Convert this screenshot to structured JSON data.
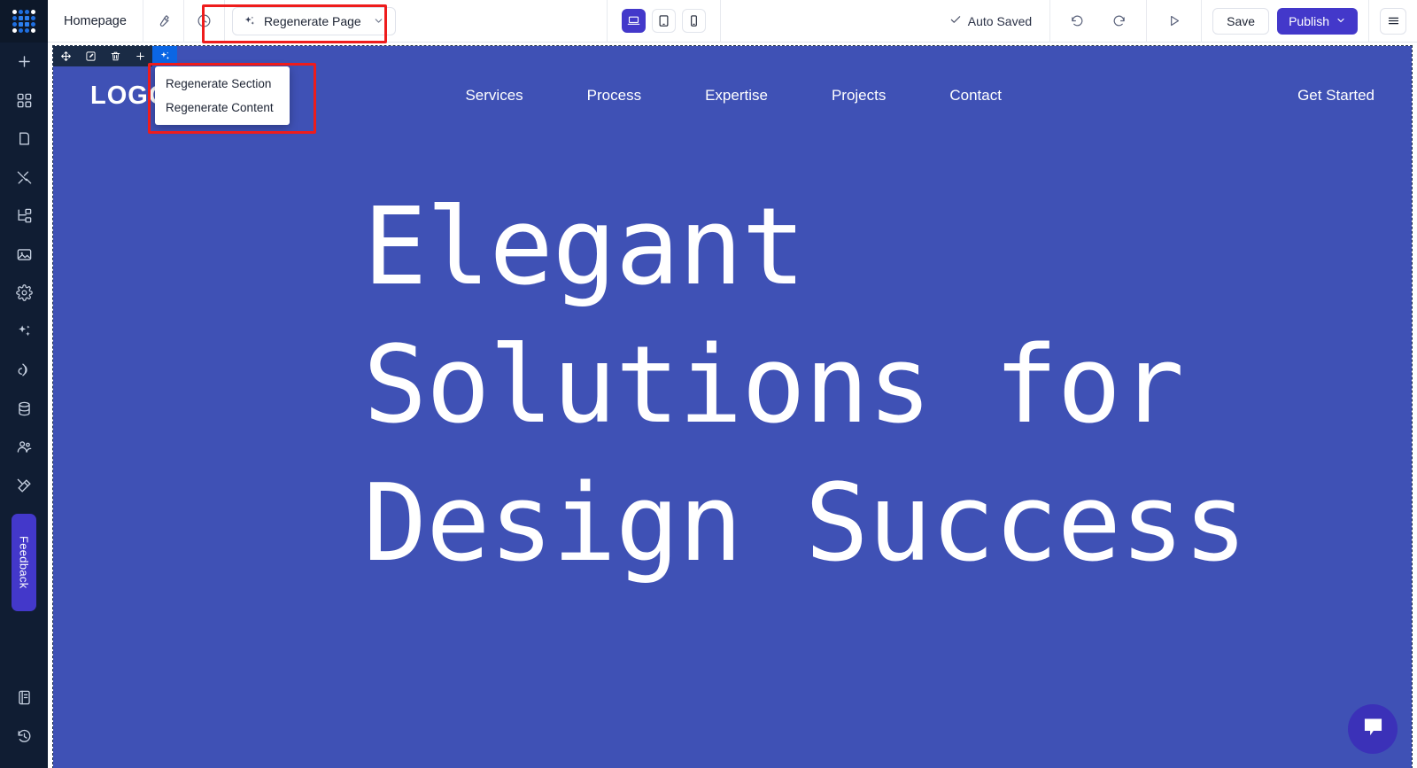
{
  "app": {
    "logo_icon": "dot-grid-logo-icon"
  },
  "sidebar": {
    "items": [
      {
        "icon": "plus-icon",
        "name": "add"
      },
      {
        "icon": "blocks-icon",
        "name": "blocks"
      },
      {
        "icon": "page-icon",
        "name": "pages"
      },
      {
        "icon": "design-icon",
        "name": "design"
      },
      {
        "icon": "sitemap-icon",
        "name": "sitemap"
      },
      {
        "icon": "image-icon",
        "name": "media"
      },
      {
        "icon": "gear-icon",
        "name": "settings"
      },
      {
        "icon": "sparkle-icon",
        "name": "ai"
      },
      {
        "icon": "broadcast-icon",
        "name": "publish"
      },
      {
        "icon": "database-icon",
        "name": "database"
      },
      {
        "icon": "users-icon",
        "name": "team"
      },
      {
        "icon": "tools-icon",
        "name": "tools"
      }
    ],
    "feedback_label": "Feedback",
    "bottom_items": [
      {
        "icon": "book-icon",
        "name": "docs"
      },
      {
        "icon": "history-icon",
        "name": "history"
      }
    ]
  },
  "topbar": {
    "page_name": "Homepage",
    "wrench_icon": "wrench-icon",
    "history_icon": "clock-icon",
    "regenerate_page": {
      "label": "Regenerate Page",
      "sparkle_icon": "sparkle-icon",
      "chevron_icon": "chevron-down-icon"
    },
    "devices": [
      {
        "name": "desktop",
        "icon": "laptop-icon",
        "active": true
      },
      {
        "name": "tablet",
        "icon": "tablet-icon",
        "active": false
      },
      {
        "name": "mobile",
        "icon": "phone-icon",
        "active": false
      }
    ],
    "auto_saved": "Auto Saved",
    "auto_saved_icon": "check-icon",
    "undo_icon": "undo-icon",
    "redo_icon": "redo-icon",
    "preview_icon": "play-icon",
    "save_label": "Save",
    "publish_label": "Publish",
    "publish_chevron_icon": "chevron-down-icon",
    "menu_icon": "hamburger-icon"
  },
  "element_toolbar": {
    "buttons": [
      {
        "name": "move",
        "icon": "move-icon",
        "active": false
      },
      {
        "name": "edit",
        "icon": "edit-icon",
        "active": false
      },
      {
        "name": "delete",
        "icon": "trash-icon",
        "active": false
      },
      {
        "name": "add",
        "icon": "plus-icon",
        "active": false
      },
      {
        "name": "regenerate",
        "icon": "sparkle-icon",
        "active": true
      }
    ]
  },
  "regenerate_menu": {
    "items": [
      {
        "label": "Regenerate Section"
      },
      {
        "label": "Regenerate Content"
      }
    ]
  },
  "site": {
    "logo_text": "LOGO",
    "nav": [
      {
        "label": "Services"
      },
      {
        "label": "Process"
      },
      {
        "label": "Expertise"
      },
      {
        "label": "Projects"
      },
      {
        "label": "Contact"
      }
    ],
    "cta_label": "Get Started",
    "hero_heading": "Elegant Solutions for Design Success",
    "chat_icon": "chat-bubble-icon"
  },
  "colors": {
    "rail_bg": "#101d33",
    "hero_bg": "#3f51b5",
    "accent_publish": "#4338ca",
    "toolbar_active": "#0b66e4",
    "annotation": "#ee1c1c",
    "chat_fab": "#3b31b8"
  }
}
